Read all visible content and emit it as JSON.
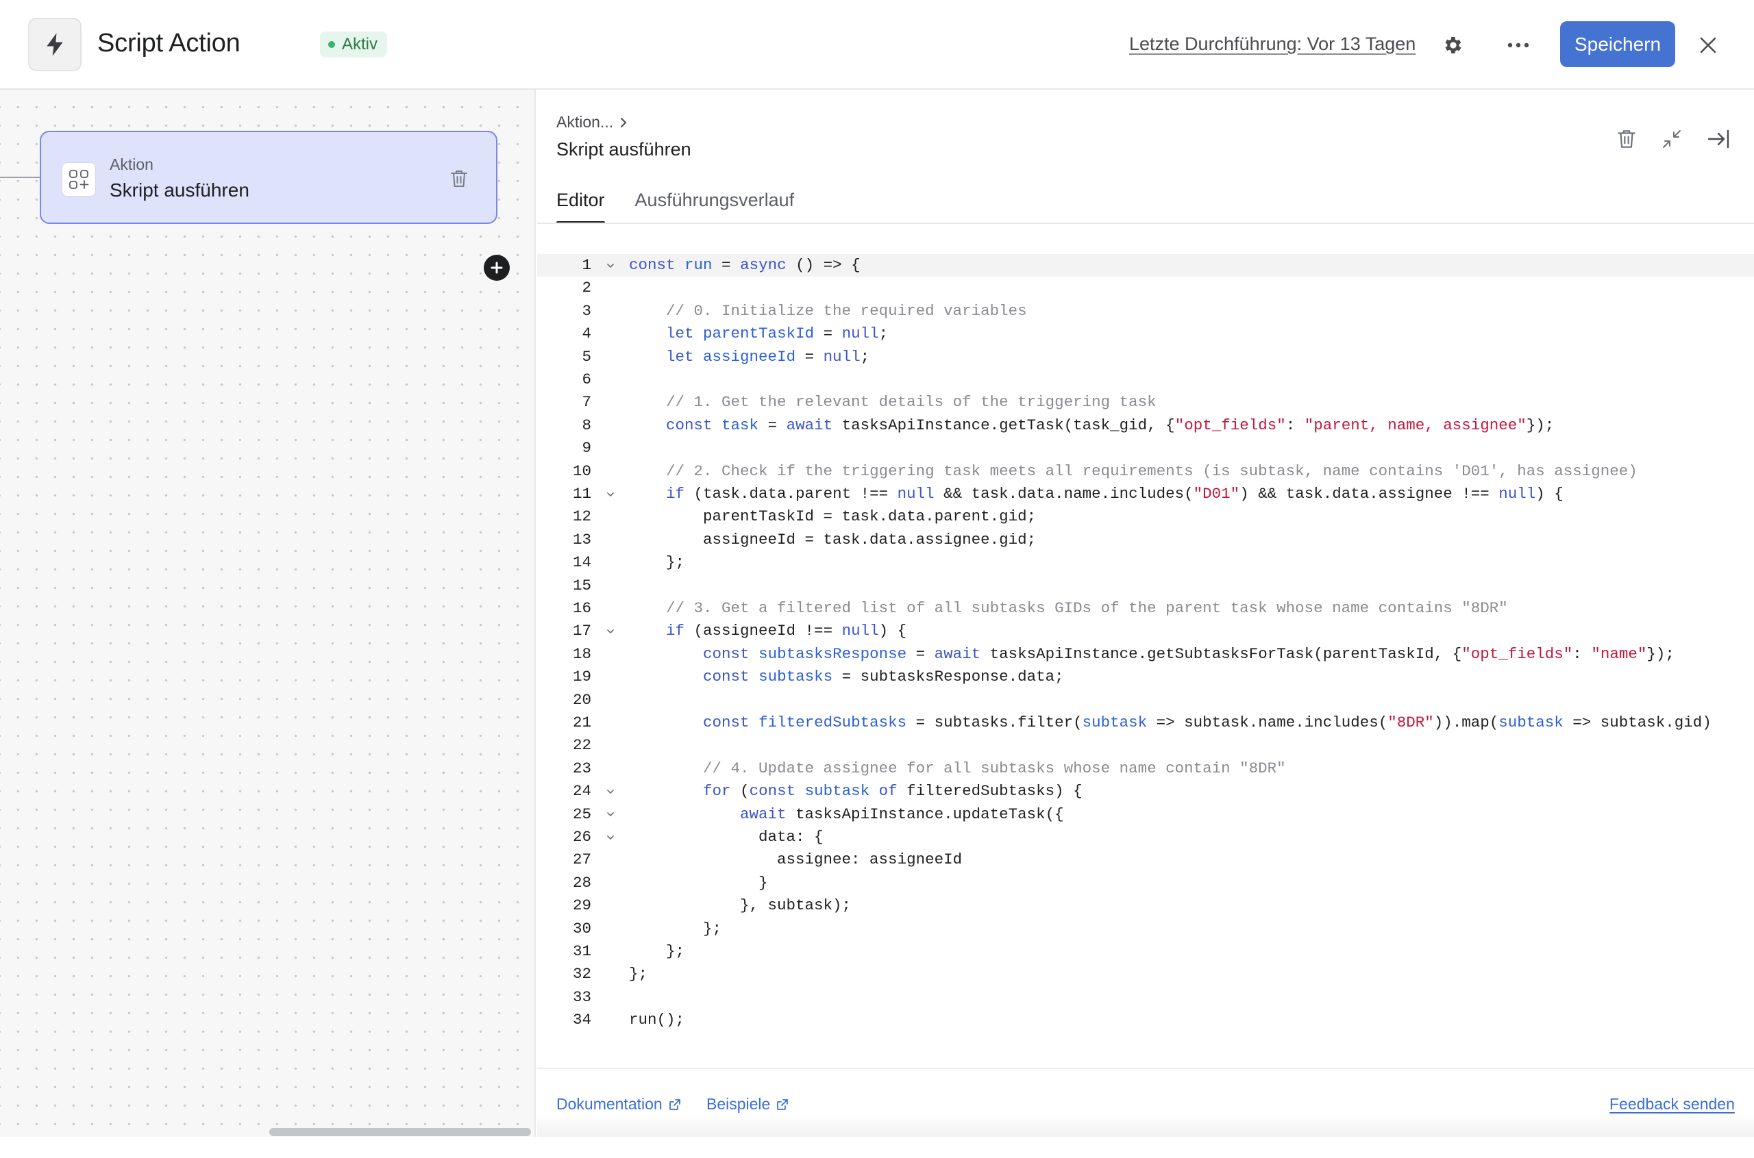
{
  "header": {
    "title": "Script Action",
    "status": "Aktiv",
    "last_run": "Letzte Durchführung: Vor 13 Tagen",
    "save_label": "Speichern"
  },
  "canvas": {
    "node": {
      "kicker": "Aktion",
      "title": "Skript ausführen"
    }
  },
  "panel": {
    "breadcrumb": "Aktion...",
    "title": "Skript ausführen",
    "tabs": [
      {
        "label": "Editor",
        "active": true
      },
      {
        "label": "Ausführungsverlauf",
        "active": false
      }
    ],
    "code": [
      {
        "n": 1,
        "fold": true,
        "t": "const run = async () => {"
      },
      {
        "n": 2,
        "fold": false,
        "t": ""
      },
      {
        "n": 3,
        "fold": false,
        "t": "    // 0. Initialize the required variables"
      },
      {
        "n": 4,
        "fold": false,
        "t": "    let parentTaskId = null;"
      },
      {
        "n": 5,
        "fold": false,
        "t": "    let assigneeId = null;"
      },
      {
        "n": 6,
        "fold": false,
        "t": ""
      },
      {
        "n": 7,
        "fold": false,
        "t": "    // 1. Get the relevant details of the triggering task"
      },
      {
        "n": 8,
        "fold": false,
        "t": "    const task = await tasksApiInstance.getTask(task_gid, {\"opt_fields\": \"parent, name, assignee\"});"
      },
      {
        "n": 9,
        "fold": false,
        "t": ""
      },
      {
        "n": 10,
        "fold": false,
        "t": "    // 2. Check if the triggering task meets all requirements (is subtask, name contains 'D01', has assignee)"
      },
      {
        "n": 11,
        "fold": true,
        "t": "    if (task.data.parent !== null && task.data.name.includes(\"D01\") && task.data.assignee !== null) {"
      },
      {
        "n": 12,
        "fold": false,
        "t": "        parentTaskId = task.data.parent.gid;"
      },
      {
        "n": 13,
        "fold": false,
        "t": "        assigneeId = task.data.assignee.gid;"
      },
      {
        "n": 14,
        "fold": false,
        "t": "    };"
      },
      {
        "n": 15,
        "fold": false,
        "t": ""
      },
      {
        "n": 16,
        "fold": false,
        "t": "    // 3. Get a filtered list of all subtasks GIDs of the parent task whose name contains \"8DR\""
      },
      {
        "n": 17,
        "fold": true,
        "t": "    if (assigneeId !== null) {"
      },
      {
        "n": 18,
        "fold": false,
        "t": "        const subtasksResponse = await tasksApiInstance.getSubtasksForTask(parentTaskId, {\"opt_fields\": \"name\"});"
      },
      {
        "n": 19,
        "fold": false,
        "t": "        const subtasks = subtasksResponse.data;"
      },
      {
        "n": 20,
        "fold": false,
        "t": ""
      },
      {
        "n": 21,
        "fold": false,
        "t": "        const filteredSubtasks = subtasks.filter(subtask => subtask.name.includes(\"8DR\")).map(subtask => subtask.gid)"
      },
      {
        "n": 22,
        "fold": false,
        "t": ""
      },
      {
        "n": 23,
        "fold": false,
        "t": "        // 4. Update assignee for all subtasks whose name contain \"8DR\""
      },
      {
        "n": 24,
        "fold": true,
        "t": "        for (const subtask of filteredSubtasks) {"
      },
      {
        "n": 25,
        "fold": true,
        "t": "            await tasksApiInstance.updateTask({"
      },
      {
        "n": 26,
        "fold": true,
        "t": "              data: {"
      },
      {
        "n": 27,
        "fold": false,
        "t": "                assignee: assigneeId"
      },
      {
        "n": 28,
        "fold": false,
        "t": "              }"
      },
      {
        "n": 29,
        "fold": false,
        "t": "            }, subtask);"
      },
      {
        "n": 30,
        "fold": false,
        "t": "        };"
      },
      {
        "n": 31,
        "fold": false,
        "t": "    };"
      },
      {
        "n": 32,
        "fold": false,
        "t": "};"
      },
      {
        "n": 33,
        "fold": false,
        "t": ""
      },
      {
        "n": 34,
        "fold": false,
        "t": "run();"
      }
    ]
  },
  "footer": {
    "docs_label": "Dokumentation",
    "examples_label": "Beispiele",
    "feedback_label": "Feedback senden"
  },
  "icons": {
    "app": "lightning-icon",
    "settings": "gear-icon",
    "more": "more-horizontal-icon",
    "close": "close-icon",
    "node": "add-widget-icon",
    "trash": "trash-icon",
    "add": "plus-circle-icon",
    "collapse": "collapse-icon",
    "dock": "collapse-panel-right-icon",
    "external": "external-link-icon"
  },
  "colors": {
    "accent": "#4573d2",
    "status_bg": "#e7f6ec",
    "status_text": "#2a7b4a",
    "node_bg": "#dfe2fb",
    "node_border": "#7a85e6",
    "keyword": "#3a54c8",
    "string": "#c3173b",
    "comment": "#8a8b90"
  }
}
